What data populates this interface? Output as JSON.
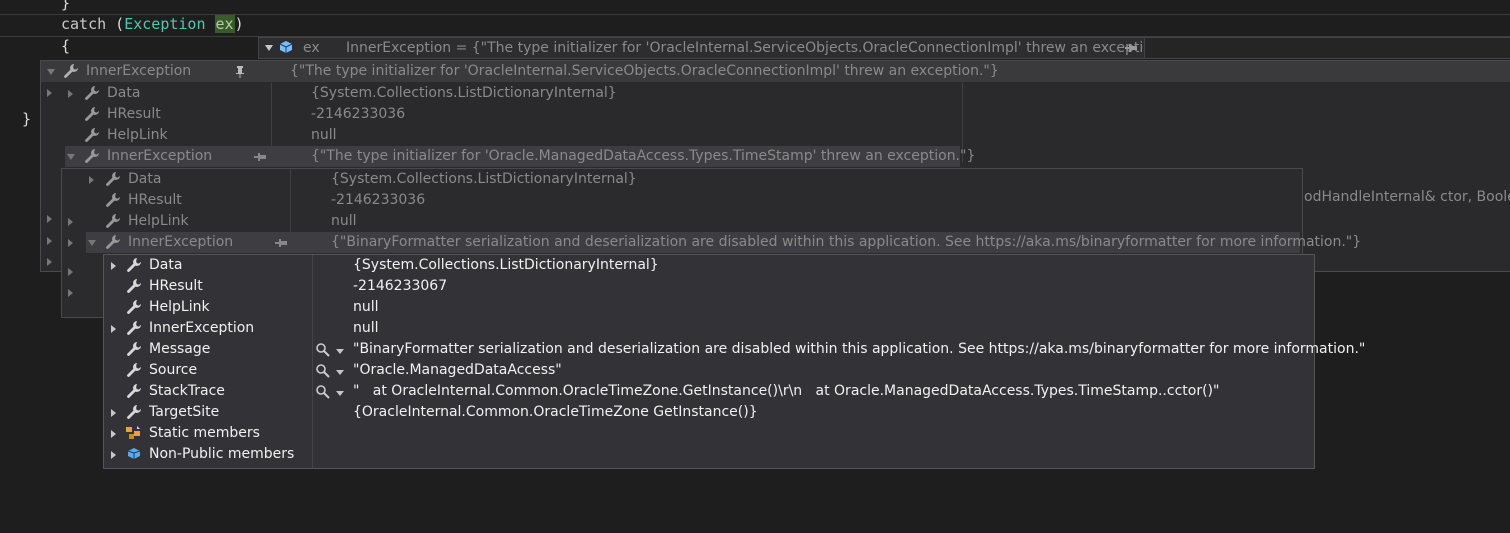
{
  "code": {
    "line1": "}",
    "catch_kw": "catch",
    "open_paren": " (",
    "exception_type": "Exception",
    "space": " ",
    "ex_var": "ex",
    "close_paren": ")",
    "brace_open": "{",
    "brace_close": "}"
  },
  "datatip": {
    "name": "ex",
    "value": "InnerException = {\"The type initializer for 'OracleInternal.ServiceObjects.OracleConnectionImpl' threw an exception.\"}"
  },
  "level1": {
    "header_name": "InnerException",
    "header_value": "{\"The type initializer for 'OracleInternal.ServiceObjects.OracleConnectionImpl' threw an exception.\"}",
    "rows": [
      {
        "name": "Data",
        "value": "{System.Collections.ListDictionaryInternal}"
      },
      {
        "name": "HResult",
        "value": "-2146233036"
      },
      {
        "name": "HelpLink",
        "value": "null"
      },
      {
        "name": "InnerException",
        "value": "{\"The type initializer for 'Oracle.ManagedDataAccess.Types.TimeStamp' threw an exception.\"}"
      }
    ],
    "side_text": "odHandleInternal& ctor, Boolea"
  },
  "level2": {
    "rows": [
      {
        "name": "Data",
        "value": "{System.Collections.ListDictionaryInternal}"
      },
      {
        "name": "HResult",
        "value": "-2146233036"
      },
      {
        "name": "HelpLink",
        "value": "null"
      },
      {
        "name": "InnerException",
        "value": "{\"BinaryFormatter serialization and deserialization are disabled within this application. See https://aka.ms/binaryformatter for more information.\"}"
      }
    ]
  },
  "level3": {
    "rows": [
      {
        "name": "Data",
        "value": "{System.Collections.ListDictionaryInternal}"
      },
      {
        "name": "HResult",
        "value": "-2146233067"
      },
      {
        "name": "HelpLink",
        "value": "null"
      },
      {
        "name": "InnerException",
        "value": "null"
      },
      {
        "name": "Message",
        "value": "\"BinaryFormatter serialization and deserialization are disabled within this application. See https://aka.ms/binaryformatter for more information.\""
      },
      {
        "name": "Source",
        "value": "\"Oracle.ManagedDataAccess\""
      },
      {
        "name": "StackTrace",
        "value": "\"   at OracleInternal.Common.OracleTimeZone.GetInstance()\\r\\n   at Oracle.ManagedDataAccess.Types.TimeStamp..cctor()\""
      },
      {
        "name": "TargetSite",
        "value": "{OracleInternal.Common.OracleTimeZone GetInstance()}"
      },
      {
        "name": "Static members",
        "value": ""
      },
      {
        "name": "Non-Public members",
        "value": ""
      }
    ]
  },
  "colors": {
    "background": "#1e1e1e",
    "panel": "#2d2d30",
    "type": "#4ec9b0",
    "highlight": "#3a5a2a"
  }
}
